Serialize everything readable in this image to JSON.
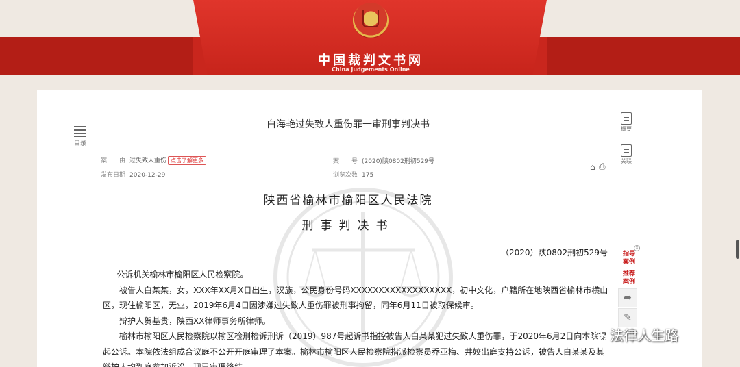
{
  "header": {
    "site_title": "中国裁判文书网",
    "site_subtitle": "China Judgements Online",
    "colors": {
      "band": "#c9261d",
      "page_bg": "#efe9e2"
    }
  },
  "sidebar_left": {
    "toc_label": "目录"
  },
  "document": {
    "title": "白海艳过失致人重伤罪一审刑事判决书",
    "meta": {
      "cause_key": "案　　由",
      "cause_value": "过失致人重伤",
      "cause_badge": "点击了解更多",
      "case_no_key": "案　　号",
      "case_no_value": "(2020)陕0802刑初529号",
      "publish_key": "发布日期",
      "publish_value": "2020-12-29",
      "views_key": "浏览次数",
      "views_value": "175"
    },
    "court_name": "陕西省榆林市榆阳区人民法院",
    "doc_type": "刑事判决书",
    "case_number": "（2020）陕0802刑初529号",
    "paragraphs": [
      "公诉机关榆林市榆阳区人民检察院。",
      "被告人白某某，女，XXX年XX月X日出生，汉族，公民身份号码XXXXXXXXXXXXXXXXXX，初中文化，户籍所在地陕西省榆林市横山区，现住榆阳区，无业，2019年6月4日因涉嫌过失致人重伤罪被刑事拘留，同年6月11日被取保候审。",
      "辩护人贺基贵，陕西XX律师事务所律师。",
      "榆林市榆阳区人民检察院以榆区检刑检诉刑诉（2019）987号起诉书指控被告人白某某犯过失致人重伤罪，于2020年6月2日向本院提起公诉。本院依法组成合议庭不公开开庭审理了本案。榆林市榆阳区人民检察院指派检察员乔亚梅、井姣出庭支持公诉，被告人白某某及其辩护人均到庭参加诉讼。现已审理终结。"
    ]
  },
  "sidebar_right": {
    "summary_label": "概要",
    "related_label": "关联",
    "guide_case": "指导案例",
    "recommend_case": "推荐案例",
    "share_icon": "share-icon",
    "edit_icon": "pencil-icon"
  },
  "watermark_brand": "法律人生路"
}
